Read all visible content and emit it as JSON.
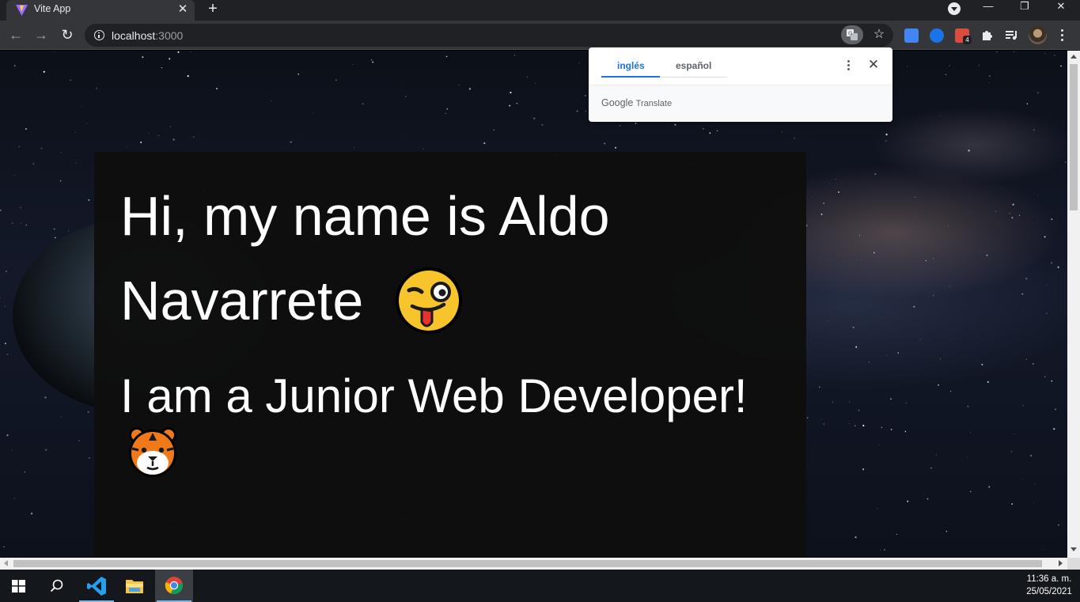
{
  "browser": {
    "tab": {
      "title": "Vite App"
    },
    "window_controls": {
      "minimize": "—",
      "restore": "❐",
      "close": "✕"
    },
    "address": {
      "host": "localhost",
      "port": ":3000"
    },
    "extensions": [
      {
        "name": "google-translate-extension",
        "color": "#4285f4"
      },
      {
        "name": "cloud-extension",
        "color": "#1a73e8"
      },
      {
        "name": "todoist-extension",
        "color": "#db4c3f",
        "badge": "4"
      },
      {
        "name": "extensions-puzzle",
        "color": "#e8eaed"
      },
      {
        "name": "media-control",
        "color": "#e8eaed"
      }
    ]
  },
  "translate_popup": {
    "tabs": [
      {
        "label": "inglés",
        "active": true
      },
      {
        "label": "español",
        "active": false
      }
    ],
    "brand_google": "Google",
    "brand_translate": "Translate",
    "close": "✕"
  },
  "page": {
    "greeting_line1": "Hi, my name is Aldo",
    "greeting_line2": "Navarrete",
    "greeting_emoji": "winking-face-with-tongue",
    "subtitle": "I am a Junior Web Developer!",
    "subtitle_emoji": "tiger-face"
  },
  "taskbar": {
    "apps": [
      "start",
      "search",
      "vscode",
      "file-explorer",
      "chrome"
    ],
    "time": "11:36 a. m.",
    "date": "25/05/2021"
  },
  "colors": {
    "chrome_dark": "#202124",
    "toolbar": "#35363a",
    "accent_blue": "#1a73e8",
    "card_bg": "#0e0e0e"
  }
}
